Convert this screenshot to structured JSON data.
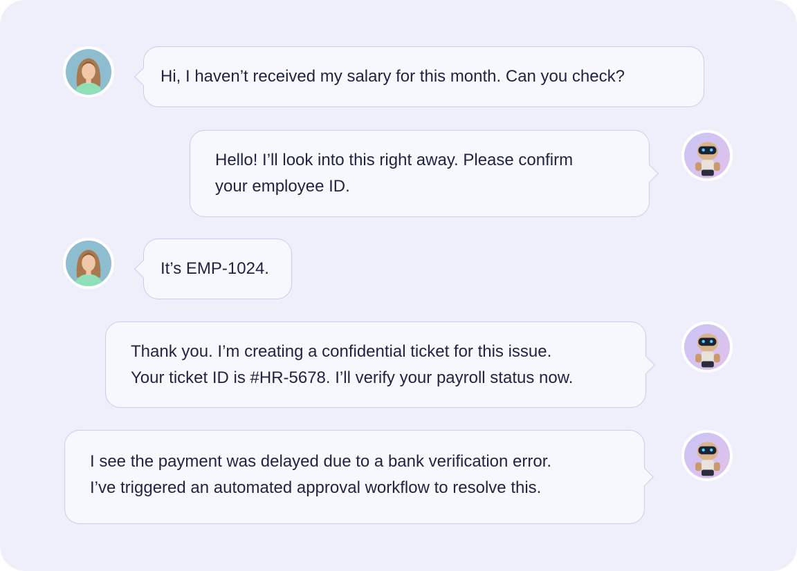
{
  "messages": [
    {
      "sender": "user",
      "text": "Hi, I haven’t received my salary for this month. Can you check?"
    },
    {
      "sender": "bot",
      "text": "Hello! I’ll look into this right away. Please confirm\nyour employee ID."
    },
    {
      "sender": "user",
      "text": "It’s EMP-1024."
    },
    {
      "sender": "bot",
      "text": "Thank you. I’m creating a confidential ticket for this issue.\nYour ticket ID is #HR-5678. I’ll verify your payroll status now."
    },
    {
      "sender": "bot",
      "text": "I see the payment was delayed due to a bank verification error.\nI’ve triggered an automated approval workflow to resolve this."
    }
  ],
  "colors": {
    "background": "#efeffb",
    "bubble": "#f7f7fe",
    "bubble_border": "#c9ccea",
    "text": "#1f2440"
  },
  "icons": {
    "user_avatar": "woman-portrait-avatar",
    "bot_avatar": "robot-avatar"
  }
}
